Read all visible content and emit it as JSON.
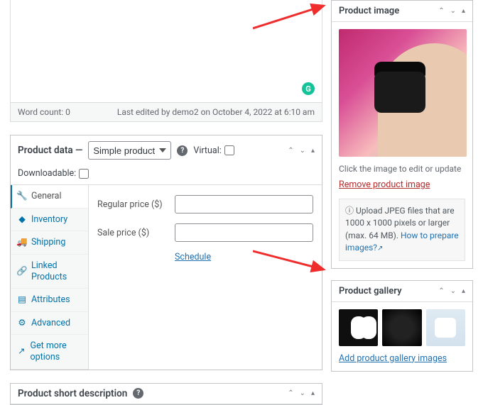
{
  "editor": {
    "word_count_label": "Word count: 0",
    "last_edited": "Last edited by demo2 on October 4, 2022 at 6:10 am",
    "grammarly_glyph": "G"
  },
  "product_data": {
    "title": "Product data  —",
    "type_selected": "Simple product",
    "virtual_label": "Virtual:",
    "downloadable_label": "Downloadable:",
    "help_glyph": "?",
    "tabs": [
      {
        "icon": "🔧",
        "label": "General",
        "active": true
      },
      {
        "icon": "◆",
        "label": "Inventory"
      },
      {
        "icon": "🚚",
        "label": "Shipping"
      },
      {
        "icon": "🔗",
        "label": "Linked Products"
      },
      {
        "icon": "▤",
        "label": "Attributes"
      },
      {
        "icon": "⚙",
        "label": "Advanced"
      },
      {
        "icon": "↗",
        "label": "Get more options"
      }
    ],
    "regular_price_label": "Regular price ($)",
    "sale_price_label": "Sale price ($)",
    "schedule_label": "Schedule"
  },
  "short_desc": {
    "title": "Product short description",
    "help_glyph": "?"
  },
  "product_image": {
    "title": "Product image",
    "click_hint": "Click the image to edit or update",
    "remove_label": "Remove product image",
    "info_prefix": "ⓘ Upload JPEG files that are 1000 x 1000 pixels or larger (max. 64 MB). ",
    "info_link": "How to prepare images?",
    "ext_glyph": "↗"
  },
  "product_gallery": {
    "title": "Product gallery",
    "add_label": "Add product gallery images"
  },
  "controls": {
    "up": "⌃",
    "down": "⌄",
    "collapse": "▴"
  }
}
